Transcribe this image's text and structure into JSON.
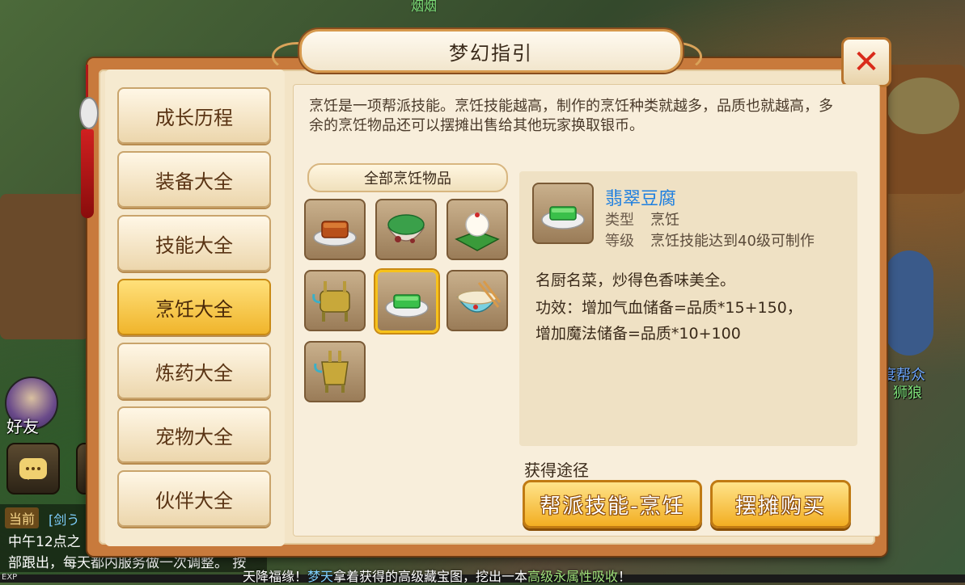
{
  "scene": {
    "top_name": "烟烟",
    "right_labels": [
      "度帮众",
      "狮狼"
    ],
    "friend_label": "好友",
    "chat": {
      "tab": "当前",
      "channel": "[剑う",
      "lines": [
        "中午12点之",
        "部跟出，每天都内服务做一次调整。 按"
      ]
    },
    "exp_label": "EXP",
    "ticker_prefix": "天降福缘！",
    "ticker_name": "梦天",
    "ticker_mid": "拿着获得的高级藏宝图，挖出一本",
    "ticker_item": "高级永属性吸收",
    "ticker_end": "！"
  },
  "dialog": {
    "title": "梦幻指引",
    "close_icon": "close-x-icon"
  },
  "nav": {
    "items": [
      {
        "label": "成长历程",
        "active": false
      },
      {
        "label": "装备大全",
        "active": false
      },
      {
        "label": "技能大全",
        "active": false
      },
      {
        "label": "烹饪大全",
        "active": true
      },
      {
        "label": "炼药大全",
        "active": false
      },
      {
        "label": "宠物大全",
        "active": false
      },
      {
        "label": "伙伴大全",
        "active": false
      }
    ]
  },
  "content": {
    "description": "烹饪是一项帮派技能。烹饪技能越高，制作的烹饪种类就越多，品质也就越高，多余的烹饪物品还可以摆摊出售给其他玩家换取银币。",
    "items_header": "全部烹饪物品",
    "items": [
      {
        "icon": "braised-meat-dish-icon",
        "selected": false
      },
      {
        "icon": "covered-bowl-dish-icon",
        "selected": false
      },
      {
        "icon": "lotus-leaf-rice-icon",
        "selected": false
      },
      {
        "icon": "bronze-tripod-cauldron-icon",
        "selected": false
      },
      {
        "icon": "green-tofu-dish-icon",
        "selected": true
      },
      {
        "icon": "noodle-bowl-chopsticks-icon",
        "selected": false
      },
      {
        "icon": "bronze-wine-vessel-icon",
        "selected": false
      }
    ],
    "detail": {
      "name": "翡翠豆腐",
      "type_key": "类型",
      "type_value": "烹饪",
      "level_key": "等级",
      "level_value": "烹饪技能达到40级可制作",
      "lines": [
        "名厨名菜，炒得色香味美全。",
        "功效：增加气血储备=品质*15+150，",
        "增加魔法储备=品质*10+100"
      ]
    },
    "obtain_label": "获得途径",
    "buttons": [
      {
        "label": "帮派技能-烹饪"
      },
      {
        "label": "摆摊购买"
      }
    ]
  }
}
